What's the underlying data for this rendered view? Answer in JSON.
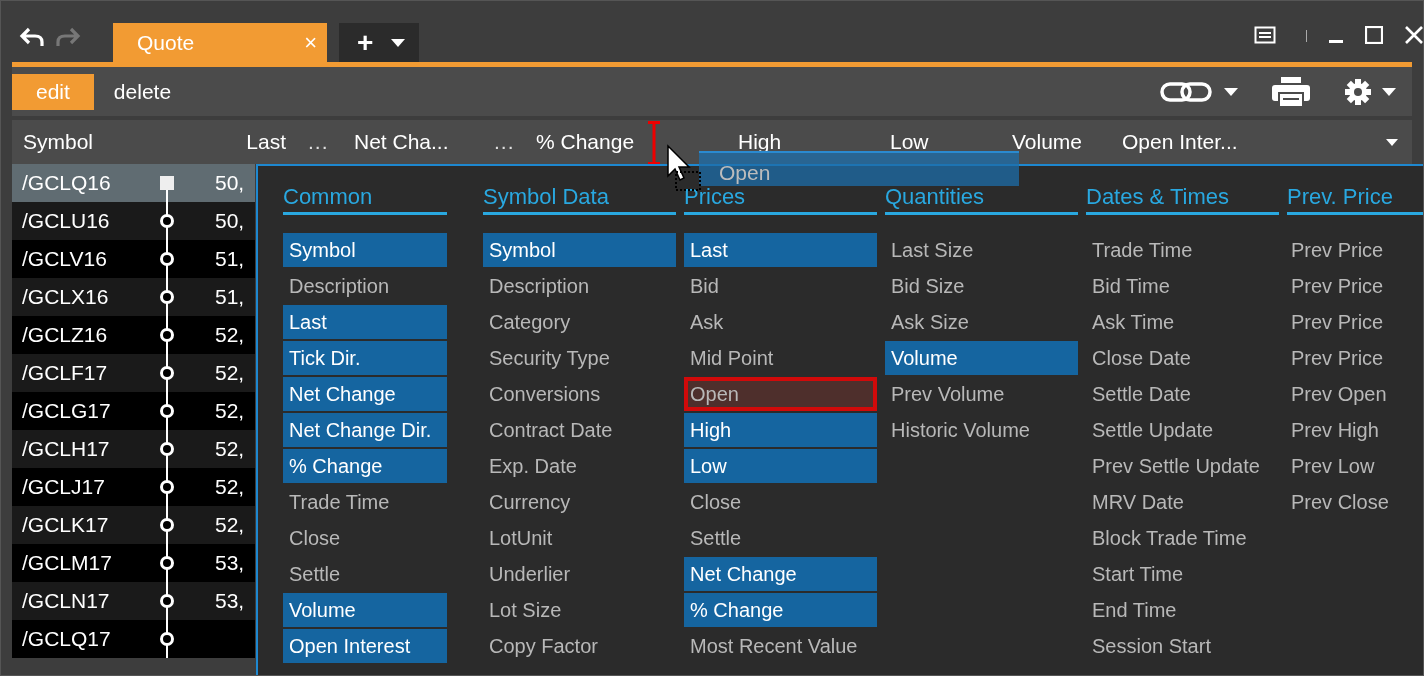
{
  "tabs": [
    {
      "label": "Quote",
      "selected": true,
      "close": "×"
    }
  ],
  "new_tab": {
    "label": "+"
  },
  "toolbar": [
    {
      "label": "edit",
      "selected": true
    },
    {
      "label": "delete",
      "selected": false
    }
  ],
  "table": {
    "columns": [
      {
        "label": "Symbol",
        "kind": "text"
      },
      {
        "label": "Last",
        "kind": "num"
      },
      {
        "label": "...",
        "kind": "more"
      },
      {
        "label": "Net Cha...",
        "kind": "text"
      },
      {
        "label": "...",
        "kind": "more"
      },
      {
        "label": "% Change",
        "kind": "text"
      },
      {
        "label": "High",
        "kind": "text"
      },
      {
        "label": "Low",
        "kind": "text"
      },
      {
        "label": "Volume",
        "kind": "text"
      },
      {
        "label": "Open Inter...",
        "kind": "text"
      }
    ],
    "rows": [
      {
        "symbol": "/GCLQ16",
        "last": "50,",
        "selected": true
      },
      {
        "symbol": "/GCLU16",
        "last": "50,",
        "selected": false
      },
      {
        "symbol": "/GCLV16",
        "last": "51,",
        "selected": false
      },
      {
        "symbol": "/GCLX16",
        "last": "51,",
        "selected": false
      },
      {
        "symbol": "/GCLZ16",
        "last": "52,",
        "selected": false
      },
      {
        "symbol": "/GCLF17",
        "last": "52,",
        "selected": false
      },
      {
        "symbol": "/GCLG17",
        "last": "52,",
        "selected": false
      },
      {
        "symbol": "/GCLH17",
        "last": "52,",
        "selected": false
      },
      {
        "symbol": "/GCLJ17",
        "last": "52,",
        "selected": false
      },
      {
        "symbol": "/GCLK17",
        "last": "52,",
        "selected": false
      },
      {
        "symbol": "/GCLM17",
        "last": "53,",
        "selected": false
      },
      {
        "symbol": "/GCLN17",
        "last": "53,",
        "selected": false
      },
      {
        "symbol": "/GCLQ17",
        "selected": false
      }
    ]
  },
  "field_picker": {
    "groups": [
      {
        "title": "Common",
        "items": [
          {
            "label": "Symbol",
            "selected": true,
            "drop_target": false
          },
          {
            "label": "Description",
            "selected": false,
            "drop_target": false
          },
          {
            "label": "Last",
            "selected": true,
            "drop_target": false
          },
          {
            "label": "Tick Dir.",
            "selected": true,
            "drop_target": false
          },
          {
            "label": "Net Change",
            "selected": true,
            "drop_target": false
          },
          {
            "label": "Net Change Dir.",
            "selected": true,
            "drop_target": false
          },
          {
            "label": "% Change",
            "selected": true,
            "drop_target": false
          },
          {
            "label": "Trade Time",
            "selected": false,
            "drop_target": false
          },
          {
            "label": "Close",
            "selected": false,
            "drop_target": false
          },
          {
            "label": "Settle",
            "selected": false,
            "drop_target": false
          },
          {
            "label": "Volume",
            "selected": true,
            "drop_target": false
          },
          {
            "label": "Open Interest",
            "selected": true,
            "drop_target": false
          }
        ]
      },
      {
        "title": "Symbol Data",
        "items": [
          {
            "label": "Symbol",
            "selected": true,
            "drop_target": false
          },
          {
            "label": "Description",
            "selected": false,
            "drop_target": false
          },
          {
            "label": "Category",
            "selected": false,
            "drop_target": false
          },
          {
            "label": "Security Type",
            "selected": false,
            "drop_target": false
          },
          {
            "label": "Conversions",
            "selected": false,
            "drop_target": false
          },
          {
            "label": "Contract Date",
            "selected": false,
            "drop_target": false
          },
          {
            "label": "Exp. Date",
            "selected": false,
            "drop_target": false
          },
          {
            "label": "Currency",
            "selected": false,
            "drop_target": false
          },
          {
            "label": "LotUnit",
            "selected": false,
            "drop_target": false
          },
          {
            "label": "Underlier",
            "selected": false,
            "drop_target": false
          },
          {
            "label": "Lot Size",
            "selected": false,
            "drop_target": false
          },
          {
            "label": "Copy Factor",
            "selected": false,
            "drop_target": false
          }
        ]
      },
      {
        "title": "Prices",
        "items": [
          {
            "label": "Last",
            "selected": true,
            "drop_target": false
          },
          {
            "label": "Bid",
            "selected": false,
            "drop_target": false
          },
          {
            "label": "Ask",
            "selected": false,
            "drop_target": false
          },
          {
            "label": "Mid Point",
            "selected": false,
            "drop_target": false
          },
          {
            "label": "Open",
            "selected": false,
            "drop_target": true
          },
          {
            "label": "High",
            "selected": true,
            "drop_target": false
          },
          {
            "label": "Low",
            "selected": true,
            "drop_target": false
          },
          {
            "label": "Close",
            "selected": false,
            "drop_target": false
          },
          {
            "label": "Settle",
            "selected": false,
            "drop_target": false
          },
          {
            "label": "Net Change",
            "selected": true,
            "drop_target": false
          },
          {
            "label": "% Change",
            "selected": true,
            "drop_target": false
          },
          {
            "label": "Most Recent Value",
            "selected": false,
            "drop_target": false
          }
        ]
      },
      {
        "title": "Quantities",
        "items": [
          {
            "label": "Last Size",
            "selected": false,
            "drop_target": false
          },
          {
            "label": "Bid Size",
            "selected": false,
            "drop_target": false
          },
          {
            "label": "Ask Size",
            "selected": false,
            "drop_target": false
          },
          {
            "label": "Volume",
            "selected": true,
            "drop_target": false
          },
          {
            "label": "Prev Volume",
            "selected": false,
            "drop_target": false
          },
          {
            "label": "Historic Volume",
            "selected": false,
            "drop_target": false
          }
        ]
      },
      {
        "title": "Dates & Times",
        "items": [
          {
            "label": "Trade Time",
            "selected": false,
            "drop_target": false
          },
          {
            "label": "Bid Time",
            "selected": false,
            "drop_target": false
          },
          {
            "label": "Ask Time",
            "selected": false,
            "drop_target": false
          },
          {
            "label": "Close Date",
            "selected": false,
            "drop_target": false
          },
          {
            "label": "Settle Date",
            "selected": false,
            "drop_target": false
          },
          {
            "label": "Settle Update",
            "selected": false,
            "drop_target": false
          },
          {
            "label": "Prev Settle Update",
            "selected": false,
            "drop_target": false
          },
          {
            "label": "MRV Date",
            "selected": false,
            "drop_target": false
          },
          {
            "label": "Block Trade Time",
            "selected": false,
            "drop_target": false
          },
          {
            "label": "Start Time",
            "selected": false,
            "drop_target": false
          },
          {
            "label": "End Time",
            "selected": false,
            "drop_target": false
          },
          {
            "label": "Session Start",
            "selected": false,
            "drop_target": false
          }
        ]
      },
      {
        "title": "Prev. Price",
        "items": [
          {
            "label": "Prev Price",
            "selected": false,
            "drop_target": false
          },
          {
            "label": "Prev Price",
            "selected": false,
            "drop_target": false
          },
          {
            "label": "Prev Price",
            "selected": false,
            "drop_target": false
          },
          {
            "label": "Prev Price",
            "selected": false,
            "drop_target": false
          },
          {
            "label": "Prev Open",
            "selected": false,
            "drop_target": false
          },
          {
            "label": "Prev High",
            "selected": false,
            "drop_target": false
          },
          {
            "label": "Prev Low",
            "selected": false,
            "drop_target": false
          },
          {
            "label": "Prev Close",
            "selected": false,
            "drop_target": false
          }
        ]
      }
    ]
  },
  "drag_ghost": {
    "label": "Open"
  }
}
